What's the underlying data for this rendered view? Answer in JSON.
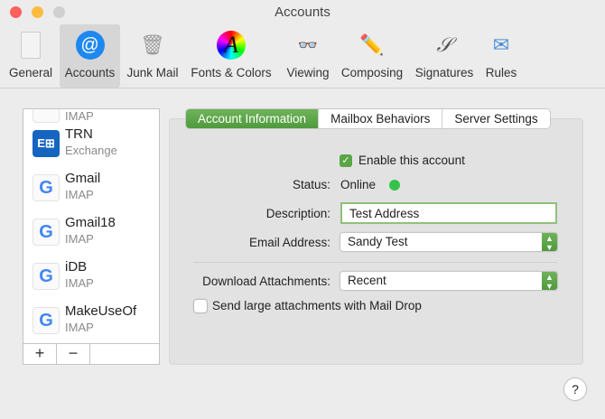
{
  "window": {
    "title": "Accounts"
  },
  "toolbar": [
    {
      "label": "General",
      "icon": "general-icon"
    },
    {
      "label": "Accounts",
      "icon": "at-sign-icon",
      "selected": true
    },
    {
      "label": "Junk Mail",
      "icon": "junk-mail-icon"
    },
    {
      "label": "Fonts & Colors",
      "icon": "fonts-colors-icon"
    },
    {
      "label": "Viewing",
      "icon": "viewing-icon"
    },
    {
      "label": "Composing",
      "icon": "composing-icon"
    },
    {
      "label": "Signatures",
      "icon": "signatures-icon"
    },
    {
      "label": "Rules",
      "icon": "rules-icon"
    }
  ],
  "accounts": [
    {
      "name": "",
      "type": "IMAP"
    },
    {
      "name": "TRN",
      "type": "Exchange"
    },
    {
      "name": "Gmail",
      "type": "IMAP"
    },
    {
      "name": "Gmail18",
      "type": "IMAP"
    },
    {
      "name": "iDB",
      "type": "IMAP"
    },
    {
      "name": "MakeUseOf",
      "type": "IMAP"
    }
  ],
  "list_buttons": {
    "add": "+",
    "remove": "−"
  },
  "tabs": [
    "Account Information",
    "Mailbox Behaviors",
    "Server Settings"
  ],
  "form": {
    "enable_label": "Enable this account",
    "enable_checked": true,
    "status_label": "Status:",
    "status_value": "Online",
    "description_label": "Description:",
    "description_value": "Test Address",
    "email_label": "Email Address:",
    "email_value": "Sandy Test",
    "download_label": "Download Attachments:",
    "download_value": "Recent",
    "maildrop_label": "Send large attachments with Mail Drop",
    "maildrop_checked": false
  },
  "help": "?",
  "colors": {
    "accent": "#5aa546",
    "online": "#35c24b"
  }
}
